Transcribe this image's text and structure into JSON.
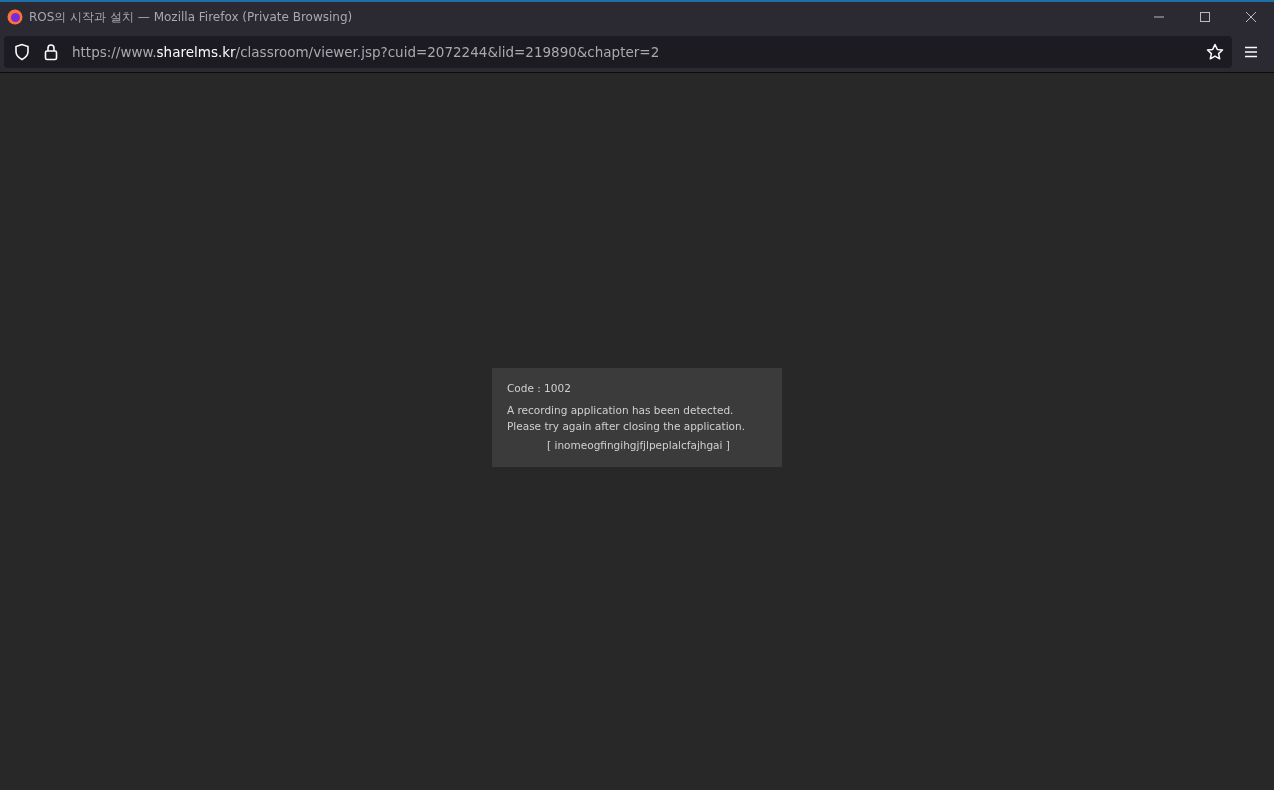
{
  "window": {
    "title": "ROS의 시작과 설치 — Mozilla Firefox (Private Browsing)"
  },
  "address_bar": {
    "url_prefix": "https://www.",
    "url_domain": "sharelms.kr",
    "url_path": "/classroom/viewer.jsp?cuid=2072244&lid=219890&chapter=2"
  },
  "dialog": {
    "code": "Code : 1002",
    "message_lines": [
      "A recording application has been detected.",
      "Please try again after closing the application."
    ],
    "detail": "[ inomeogfingihgjfjlpeplalcfajhgai ]"
  }
}
